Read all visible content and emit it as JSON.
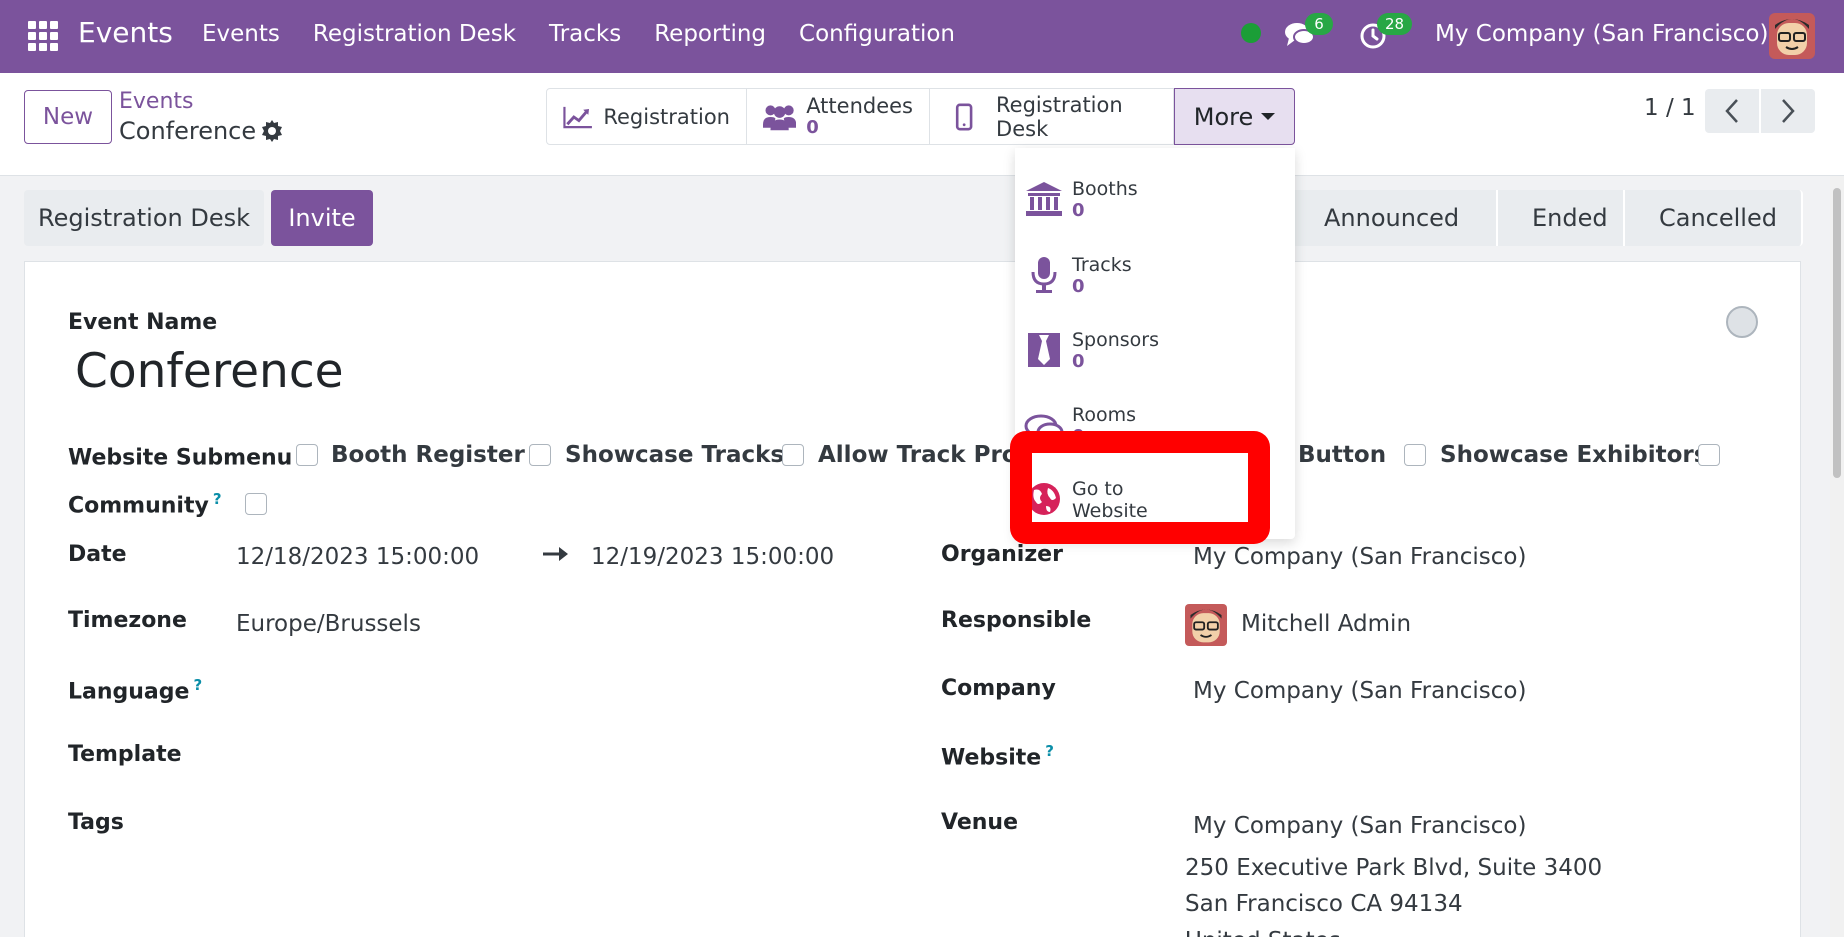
{
  "navbar": {
    "brand": "Events",
    "menu": [
      "Events",
      "Registration Desk",
      "Tracks",
      "Reporting",
      "Configuration"
    ],
    "chat_count": "6",
    "activity_count": "28",
    "company": "My Company (San Francisco)"
  },
  "control": {
    "new_label": "New",
    "breadcrumb_parent": "Events",
    "breadcrumb_current": "Conference",
    "smart": {
      "registration": "Registration",
      "attendees": "Attendees",
      "attendees_count": "0",
      "registration_desk": "Registration Desk",
      "more": "More"
    },
    "pager": "1 / 1"
  },
  "dropdown": {
    "items": [
      {
        "label": "Booths",
        "count": "0"
      },
      {
        "label": "Tracks",
        "count": "0"
      },
      {
        "label": "Sponsors",
        "count": "0"
      },
      {
        "label": "Rooms",
        "count": "0"
      },
      {
        "label": "Go to Website",
        "line1": "Go to",
        "line2": "Website"
      }
    ]
  },
  "statusbar": {
    "registration_desk": "Registration Desk",
    "invite": "Invite",
    "stages": [
      "Announced",
      "Ended",
      "Cancelled"
    ]
  },
  "form": {
    "event_name_label": "Event Name",
    "event_name": "Conference",
    "website_submenu_label": "Website Submenu",
    "checkboxes": [
      "Booth Register",
      "Showcase Tracks",
      "Allow Track Prop",
      "Button",
      "Showcase Exhibitors"
    ],
    "community_label": "Community",
    "date_label": "Date",
    "date_start": "12/18/2023 15:00:00",
    "date_end": "12/19/2023 15:00:00",
    "timezone_label": "Timezone",
    "timezone": "Europe/Brussels",
    "language_label": "Language",
    "template_label": "Template",
    "tags_label": "Tags",
    "organizer_label": "Organizer",
    "organizer": "My Company (San Francisco)",
    "responsible_label": "Responsible",
    "responsible": "Mitchell Admin",
    "company_label": "Company",
    "company": "My Company (San Francisco)",
    "website_label": "Website",
    "venue_label": "Venue",
    "venue": "My Company (San Francisco)",
    "address_line1": "250 Executive Park Blvd, Suite 3400",
    "address_line2": "San Francisco CA 94134",
    "address_line3": "United States"
  }
}
